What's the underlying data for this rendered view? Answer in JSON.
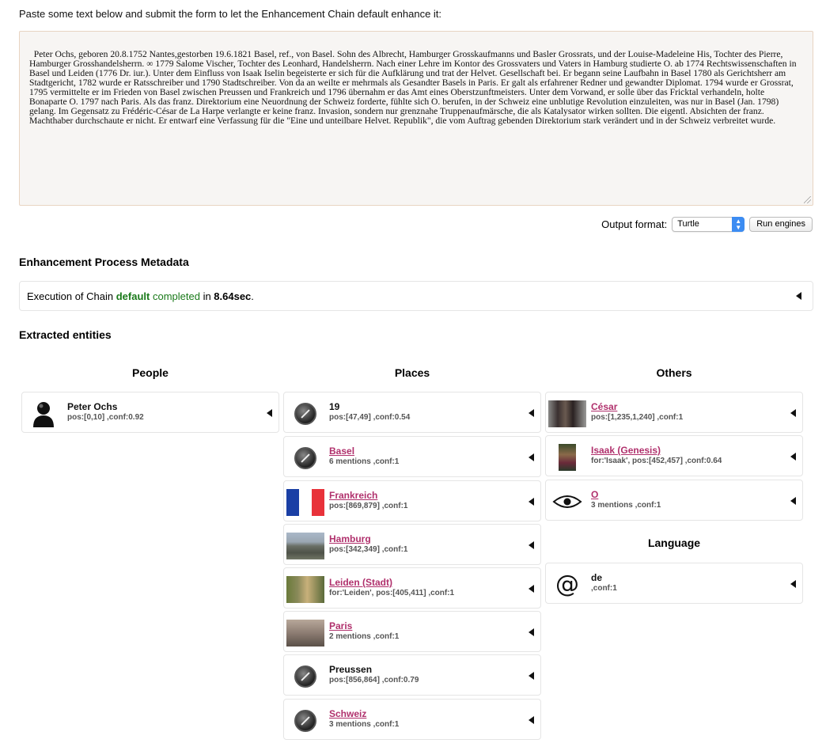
{
  "intro": "Paste some text below and submit the form to let the Enhancement Chain default enhance it:",
  "input_text": "Peter Ochs, geboren 20.8.1752 Nantes,gestorben 19.6.1821 Basel, ref., von Basel. Sohn des Albrecht, Hamburger Grosskaufmanns und Basler Grossrats, und der Louise-Madeleine His, Tochter des Pierre, Hamburger Grosshandelsherrn. ∞ 1779 Salome Vischer, Tochter des Leonhard, Handelsherrn. Nach einer Lehre im Kontor des Grossvaters und Vaters in Hamburg studierte O. ab 1774 Rechtswissenschaften in Basel und Leiden (1776 Dr. iur.). Unter dem Einfluss von Isaak Iselin begeisterte er sich für die Aufklärung und trat der Helvet. Gesellschaft bei. Er begann seine Laufbahn in Basel 1780 als Gerichtsherr am Stadtgericht, 1782 wurde er Ratsschreiber und 1790 Stadtschreiber. Von da an weilte er mehrmals als Gesandter Basels in Paris. Er galt als erfahrener Redner und gewandter Diplomat. 1794 wurde er Grossrat, 1795 vermittelte er im Frieden von Basel zwischen Preussen und Frankreich und 1796 übernahm er das Amt eines Oberstzunftmeisters. Unter dem Vorwand, er solle über das Fricktal verhandeln, holte Bonaparte O. 1797 nach Paris. Als das franz. Direktorium eine Neuordnung der Schweiz forderte, fühlte sich O. berufen, in der Schweiz eine unblutige Revolution einzuleiten, was nur in Basel (Jan. 1798) gelang. Im Gegensatz zu Frédéric-César de La Harpe verlangte er keine franz. Invasion, sondern nur grenznahe Truppenaufmärsche, die als Katalysator wirken sollten. Die eigentl. Absichten der franz. Machthaber durchschaute er nicht. Er entwarf eine Verfassung für die \"Eine und unteilbare Helvet. Republik\", die vom Auftrag gebenden Direktorium stark verändert und in der Schweiz verbreitet wurde.",
  "output_format": {
    "label": "Output format:",
    "selected": "Turtle",
    "run_label": "Run engines"
  },
  "metadata": {
    "heading": "Enhancement Process Metadata",
    "pre": "Execution of Chain ",
    "chain": "default",
    "mid": " completed",
    "in": " in ",
    "time": "8.64sec",
    "post": "."
  },
  "entities_heading": "Extracted entities",
  "columns": {
    "people": "People",
    "places": "Places",
    "others": "Others",
    "language": "Language"
  },
  "people": [
    {
      "name": "Peter Ochs",
      "meta": "pos:[0,10] ,conf:0.92",
      "icon": "person-icon",
      "link": false
    }
  ],
  "places": [
    {
      "name": "19",
      "meta": "pos:[47,49] ,conf:0.54",
      "icon": "compass-icon",
      "link": false
    },
    {
      "name": "Basel",
      "meta": "6 mentions ,conf:1",
      "icon": "compass-icon",
      "link": true
    },
    {
      "name": "Frankreich",
      "meta": "pos:[869,879] ,conf:1",
      "icon": "flag-france",
      "link": true
    },
    {
      "name": "Hamburg",
      "meta": "pos:[342,349] ,conf:1",
      "icon": "city-photo",
      "link": true
    },
    {
      "name": "Leiden (Stadt)",
      "meta": "for:'Leiden', pos:[405,411] ,conf:1",
      "icon": "canal-photo",
      "link": true
    },
    {
      "name": "Paris",
      "meta": "2 mentions ,conf:1",
      "icon": "skyline-photo",
      "link": true
    },
    {
      "name": "Preussen",
      "meta": "pos:[856,864] ,conf:0.79",
      "icon": "compass-icon",
      "link": false
    },
    {
      "name": "Schweiz",
      "meta": "3 mentions ,conf:1",
      "icon": "compass-icon",
      "link": true
    }
  ],
  "others": [
    {
      "name": "César",
      "meta": "pos:[1,235,1,240] ,conf:1",
      "icon": "group-photo",
      "link": true
    },
    {
      "name": "Isaak (Genesis)",
      "meta": "for:'Isaak', pos:[452,457] ,conf:0.64",
      "icon": "painting-photo",
      "link": true
    },
    {
      "name": "O",
      "meta": "3 mentions ,conf:1",
      "icon": "eye-icon",
      "link": true
    }
  ],
  "language": [
    {
      "name": "de",
      "meta": ",conf:1",
      "icon": "at-icon",
      "link": false
    }
  ],
  "colors": {
    "link": "#b0306c",
    "green": "#1a7a1a",
    "select_accent": "#3c8cf2"
  }
}
